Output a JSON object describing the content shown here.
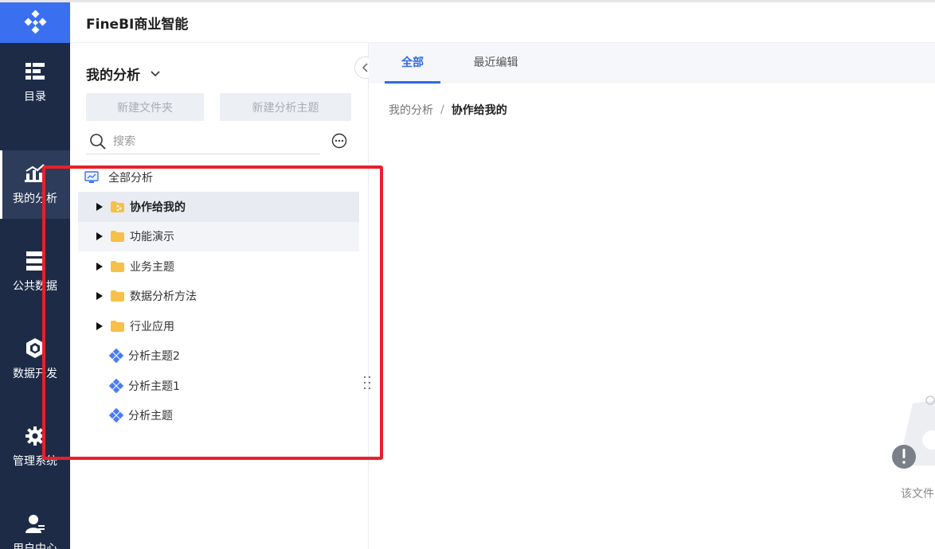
{
  "app": {
    "title": "FineBI商业智能"
  },
  "nav": {
    "items": [
      {
        "label": "目录",
        "icon": "catalog-icon"
      },
      {
        "label": "我的分析",
        "icon": "my-analysis-icon",
        "active": true
      },
      {
        "label": "公共数据",
        "icon": "public-data-icon"
      },
      {
        "label": "数据开发",
        "icon": "data-dev-icon"
      },
      {
        "label": "管理系统",
        "icon": "gear-icon"
      },
      {
        "label": "用户中心",
        "icon": "user-icon"
      }
    ]
  },
  "panel": {
    "title": "我的分析",
    "new_folder_label": "新建文件夹",
    "new_theme_label": "新建分析主题",
    "search_placeholder": "搜索",
    "tree": {
      "root_label": "全部分析",
      "items": [
        {
          "label": "协作给我的",
          "type": "shared-folder",
          "expandable": true,
          "selected": true
        },
        {
          "label": "功能演示",
          "type": "folder",
          "expandable": true
        },
        {
          "label": "业务主题",
          "type": "folder",
          "expandable": true
        },
        {
          "label": "数据分析方法",
          "type": "folder",
          "expandable": true
        },
        {
          "label": "行业应用",
          "type": "folder",
          "expandable": true
        },
        {
          "label": "分析主题2",
          "type": "theme",
          "expandable": false
        },
        {
          "label": "分析主题1",
          "type": "theme",
          "expandable": false
        },
        {
          "label": "分析主题",
          "type": "theme",
          "expandable": false
        }
      ]
    }
  },
  "main": {
    "tabs": [
      {
        "label": "全部",
        "active": true
      },
      {
        "label": "最近编辑",
        "active": false
      }
    ],
    "breadcrumb": {
      "parent": "我的分析",
      "separator": "/",
      "current": "协作给我的"
    },
    "empty_text": "该文件"
  },
  "colors": {
    "nav_bg": "#1d2b47",
    "logo_bg": "#3a6ff0",
    "accent": "#2f6ae6",
    "folder": "#f7c04a",
    "annotation": "#e8202a"
  }
}
